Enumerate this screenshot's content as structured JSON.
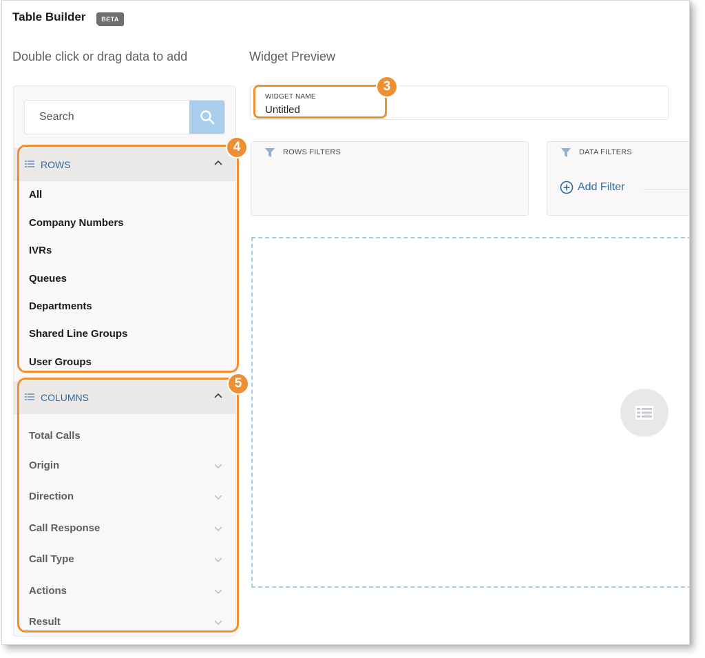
{
  "header": {
    "title": "Table Builder",
    "badge": "BETA"
  },
  "left": {
    "heading": "Double click or drag data to add",
    "search": {
      "placeholder": "Search",
      "value": ""
    },
    "rows": {
      "label": "ROWS",
      "items": [
        "All",
        "Company Numbers",
        "IVRs",
        "Queues",
        "Departments",
        "Shared Line Groups",
        "User Groups"
      ]
    },
    "columns": {
      "label": "COLUMNS",
      "items": [
        "Total Calls",
        "Origin",
        "Direction",
        "Call Response",
        "Call Type",
        "Actions",
        "Result"
      ]
    }
  },
  "right": {
    "heading": "Widget Preview",
    "widget_name": {
      "label": "WIDGET NAME",
      "value": "Untitled"
    },
    "rows_filters": {
      "label": "ROWS FILTERS"
    },
    "data_filters": {
      "label": "DATA FILTERS",
      "add_label": "Add Filter"
    }
  },
  "annotations": {
    "widget_name": "3",
    "rows": "4",
    "columns": "5"
  },
  "colors": {
    "accent_blue": "#2b6aa6",
    "annotation_orange": "#ef8f34",
    "search_button": "#a9cdec"
  },
  "icons": {
    "search": "search-icon",
    "list": "list-icon",
    "collapse": "chevron-up-icon",
    "expand": "chevron-down-icon",
    "filter": "filter-icon",
    "add": "plus-circle-icon",
    "table": "table-icon"
  }
}
